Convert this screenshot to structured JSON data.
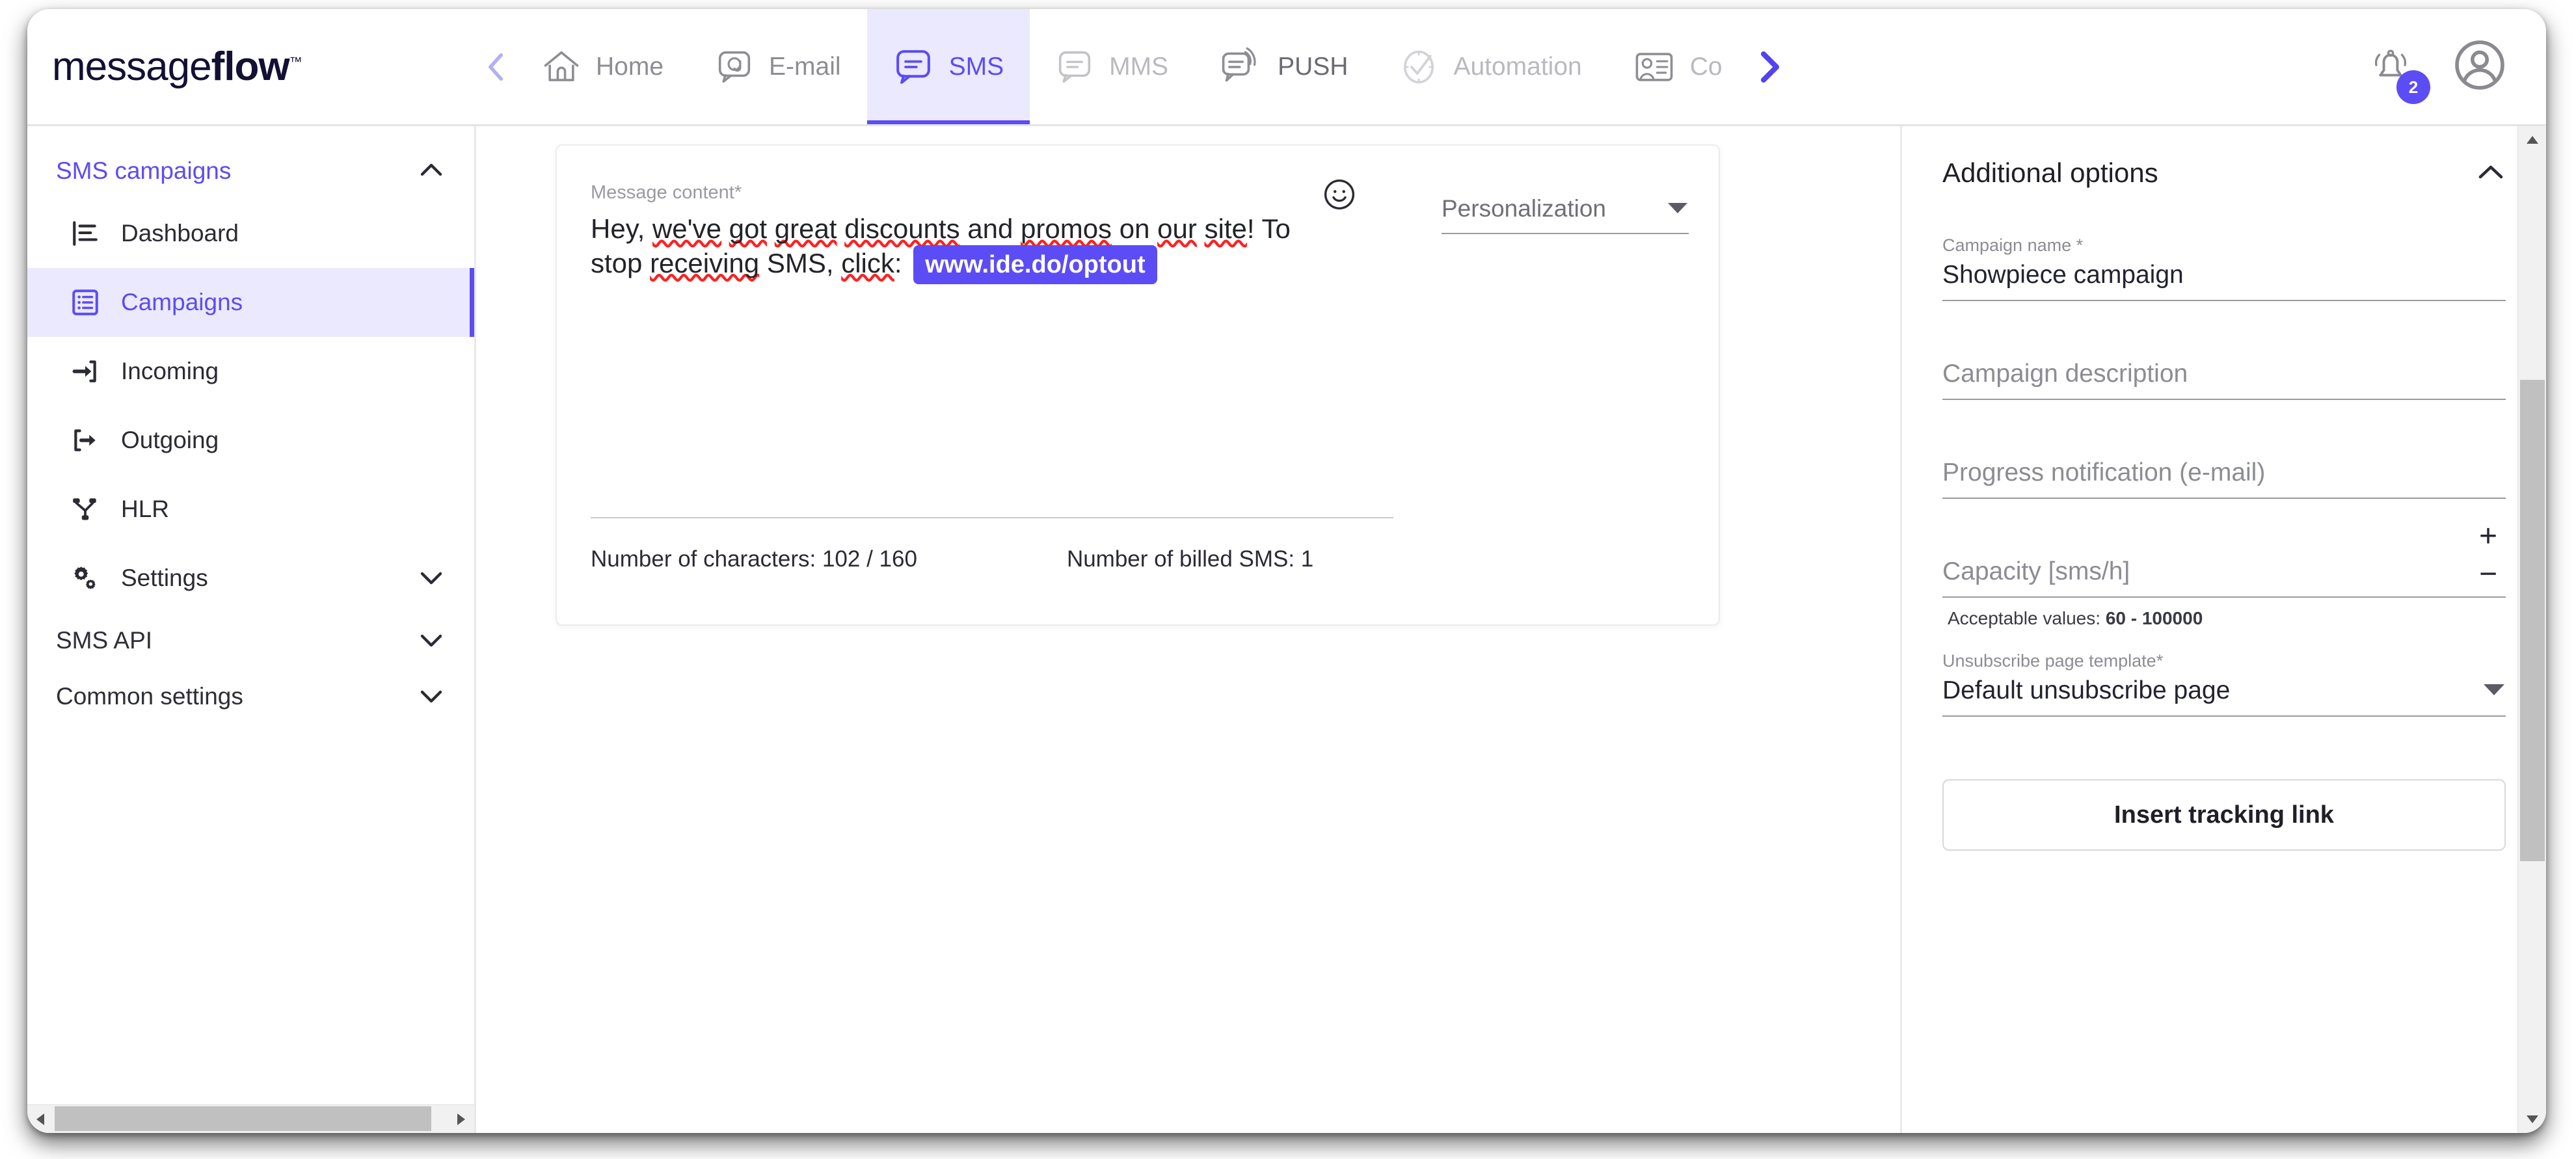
{
  "brand": {
    "logo_light": "message",
    "logo_bold": "flow",
    "logo_tm": "™",
    "accent_color": "#5c4cf5",
    "logo_color": "#131035"
  },
  "topnav": {
    "prev_arrow_icon": "chevron-left-icon",
    "next_arrow_icon": "chevron-right-icon",
    "tabs": [
      {
        "label": "Home",
        "icon": "home-icon",
        "state": "default"
      },
      {
        "label": "E-mail",
        "icon": "email-bubble-icon",
        "state": "default"
      },
      {
        "label": "SMS",
        "icon": "sms-bubble-icon",
        "state": "active"
      },
      {
        "label": "MMS",
        "icon": "mms-bubble-icon",
        "state": "muted"
      },
      {
        "label": "PUSH",
        "icon": "push-bubble-icon",
        "state": "dark"
      },
      {
        "label": "Automation",
        "icon": "clock-check-icon",
        "state": "muted"
      },
      {
        "label": "Co",
        "icon": "contact-card-icon",
        "state": "muted"
      }
    ],
    "notifications": {
      "icon": "bell-icon",
      "badge_count": "2"
    },
    "account": {
      "icon": "user-avatar-icon"
    }
  },
  "sidebar": {
    "section_title": "SMS campaigns",
    "section_chevron": "chevron-up-icon",
    "items": [
      {
        "label": "Dashboard",
        "icon": "bar-chart-icon",
        "active": false,
        "chevron": ""
      },
      {
        "label": "Campaigns",
        "icon": "list-box-icon",
        "active": true,
        "chevron": ""
      },
      {
        "label": "Incoming",
        "icon": "arrow-in-icon",
        "active": false,
        "chevron": ""
      },
      {
        "label": "Outgoing",
        "icon": "arrow-out-icon",
        "active": false,
        "chevron": ""
      },
      {
        "label": "HLR",
        "icon": "network-node-icon",
        "active": false,
        "chevron": ""
      },
      {
        "label": "Settings",
        "icon": "gears-icon",
        "active": false,
        "chevron": "chevron-down-icon"
      }
    ],
    "groups": [
      {
        "label": "SMS API",
        "chevron": "chevron-down-icon"
      },
      {
        "label": "Common settings",
        "chevron": "chevron-down-icon"
      }
    ],
    "hscroll": {
      "left_icon": "scroll-left-arrow",
      "right_icon": "scroll-right-arrow"
    }
  },
  "message_card": {
    "label": "Message content*",
    "text_part1": "Hey, ",
    "text_we_ve": "we've",
    "text_sp1": " ",
    "text_got": "got",
    "text_sp2": " ",
    "text_great": "great",
    "text_sp3": " ",
    "text_discounts": "discounts",
    "text_and": " and ",
    "text_promos": "promos",
    "text_on": " on ",
    "text_our": "our",
    "text_sp4": " ",
    "text_site": "site",
    "text_excl": "! To ",
    "text_stop": "stop ",
    "text_receiving": "receiving",
    "text_sms": " SMS, ",
    "text_click": "click",
    "text_colon": ": ",
    "optout_link": "www.ide.do/optout",
    "emoji_button_icon": "smiley-icon",
    "personalization_label": "Personalization",
    "personalization_chevron": "caret-down-icon",
    "char_count": "Number of characters: 102 / 160",
    "billed_sms": "Number of billed SMS: 1"
  },
  "additional_options": {
    "title": "Additional options",
    "collapse_chevron": "chevron-up-icon",
    "campaign_name_label": "Campaign name *",
    "campaign_name_value": "Showpiece campaign",
    "campaign_description_placeholder": "Campaign description",
    "progress_notification_placeholder": "Progress notification (e-mail)",
    "capacity_placeholder": "Capacity [sms/h]",
    "capacity_increase": "+",
    "capacity_decrease": "−",
    "capacity_helper_prefix": "Acceptable values: ",
    "capacity_helper_range": "60 - 100000",
    "unsubscribe_label": "Unsubscribe page template*",
    "unsubscribe_value": "Default unsubscribe page",
    "unsubscribe_chevron": "caret-down-icon",
    "insert_tracking_link": "Insert tracking link"
  },
  "scrollbars": {
    "vertical_up_icon": "scroll-up-arrow",
    "vertical_down_icon": "scroll-down-arrow"
  }
}
